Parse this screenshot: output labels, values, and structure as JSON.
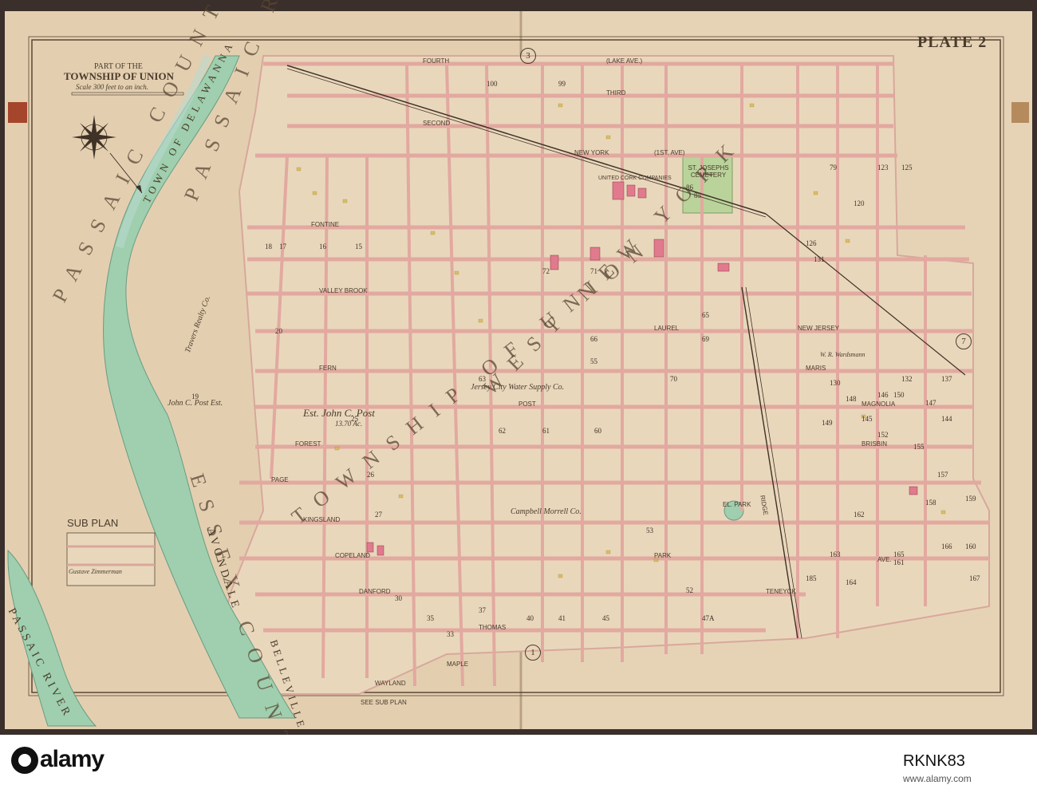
{
  "plate": "PLATE 2",
  "title": {
    "part": "PART OF THE",
    "main": "TOWNSHIP OF UNION",
    "scale": "Scale 300 feet to an inch."
  },
  "sheet_numbers": {
    "top": "3",
    "right": "7",
    "bottom": "1"
  },
  "region_labels": {
    "passaic_county": "PASSAIC COUNTY",
    "delawanna": "TOWN OF DELAWANNA",
    "passaic_river": "PASSAIC RIVER",
    "essex_county": "ESSEX COUNTY",
    "avondale": "AVONDALE",
    "belleville": "BELLEVILLE",
    "sub_plan": "SUB PLAN",
    "sub_river": "PASSAIC RIVER",
    "see_sub_plan": "SEE SUB PLAN",
    "township_diag": "TOWNSHIP OF UNION",
    "west_hoboken": "WEST NEW YORK"
  },
  "streets": {
    "fourth": "FOURTH",
    "lake_ave": "(LAKE AVE.)",
    "third": "THIRD",
    "second": "SECOND",
    "new_york": "NEW YORK",
    "first": "(1ST. AVE)",
    "fontine": "FONTINE",
    "valley_brook": "VALLEY   BROOK",
    "fern": "FERN",
    "post": "POST",
    "forest": "FOREST",
    "page": "PAGE",
    "kingsland": "KINGSLAND",
    "copeland": "COPELAND",
    "danford": "DANFORD",
    "thomas": "THOMAS",
    "maple": "MAPLE",
    "wayland": "WAYLAND",
    "teneyck": "TENEYCK",
    "park": "PARK",
    "ridge": "RIDGE",
    "new_jersey": "NEW JERSEY",
    "maris": "MARIS",
    "magnolia": "MAGNOLIA",
    "brisbin": "BRISBIN",
    "laurel": "LAUREL",
    "ave": "AVE."
  },
  "landmarks": {
    "cemetery": "ST. JOSEPHS CEMETERY",
    "el_park": "EL. PARK",
    "post_est": "Est. John C. Post",
    "post_est_sub": "13.70 Ac.",
    "post_est2": "John C. Post Est.",
    "realty": "Travers Realty Co.",
    "water": "Jersey City Water Supply Co.",
    "campbell": "Campbell Morrell Co.",
    "cork": "UNITED CORK COMPANIES",
    "zimmerman": "Gustave Zimmerman",
    "wardsmann": "W. R. Wardsmann"
  },
  "blocks": [
    "85",
    "86",
    "99",
    "100",
    "18",
    "17",
    "16",
    "15",
    "19",
    "20",
    "25",
    "26",
    "27",
    "30",
    "33",
    "35",
    "37",
    "40",
    "41",
    "45",
    "47A",
    "52",
    "53",
    "55",
    "60",
    "61",
    "62",
    "63",
    "65",
    "66",
    "69",
    "70",
    "71",
    "72",
    "79",
    "120",
    "123",
    "125",
    "126",
    "130",
    "131",
    "132",
    "137",
    "144",
    "145",
    "146",
    "147",
    "148",
    "149",
    "150",
    "152",
    "155",
    "157",
    "158",
    "159",
    "160",
    "161",
    "162",
    "163",
    "164",
    "165",
    "166",
    "167",
    "185"
  ],
  "banner": {
    "brand": "alamy",
    "id": "RKNK83",
    "url": "www.alamy.com"
  }
}
